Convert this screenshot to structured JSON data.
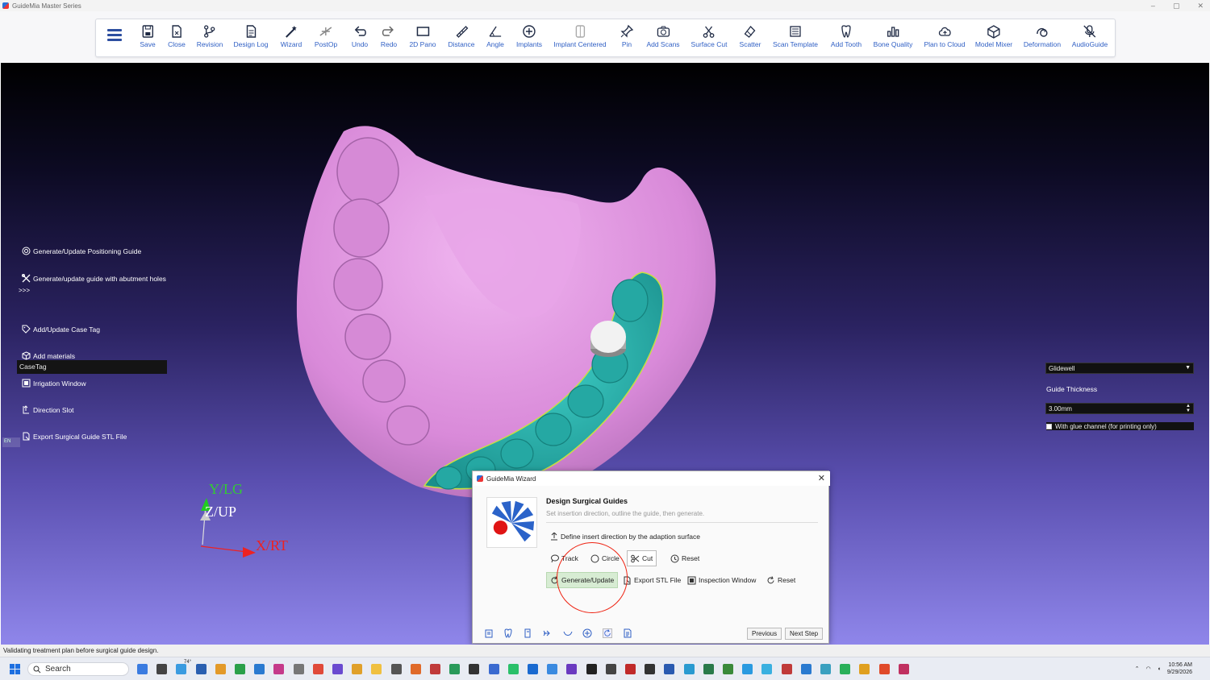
{
  "window": {
    "title": "GuideMia Master Series",
    "controls": [
      "–",
      "▢",
      "✕"
    ]
  },
  "toolbar": {
    "items": [
      {
        "label": "Save",
        "icon": "save-icon"
      },
      {
        "label": "Close",
        "icon": "close-file-icon"
      },
      {
        "label": "Revision",
        "icon": "revision-icon"
      },
      {
        "label": "Design Log",
        "icon": "design-log-icon"
      },
      {
        "label": "Wizard",
        "icon": "wizard-icon"
      },
      {
        "label": "PostOp",
        "icon": "postop-icon"
      },
      {
        "label": "Undo",
        "icon": "undo-icon"
      },
      {
        "label": "Redo",
        "icon": "redo-icon"
      },
      {
        "label": "2D Pano",
        "icon": "pano-icon"
      },
      {
        "label": "Distance",
        "icon": "distance-icon"
      },
      {
        "label": "Angle",
        "icon": "angle-icon"
      },
      {
        "label": "Implants",
        "icon": "implants-icon"
      },
      {
        "label": "Implant Centered",
        "icon": "implant-centered-icon"
      },
      {
        "label": "Pin",
        "icon": "pin-icon"
      },
      {
        "label": "Add Scans",
        "icon": "add-scans-icon"
      },
      {
        "label": "Surface Cut",
        "icon": "surface-cut-icon"
      },
      {
        "label": "Scatter",
        "icon": "scatter-icon"
      },
      {
        "label": "Scan Template",
        "icon": "scan-template-icon"
      },
      {
        "label": "Add Tooth",
        "icon": "add-tooth-icon"
      },
      {
        "label": "Bone Quality",
        "icon": "bone-quality-icon"
      },
      {
        "label": "Plan to Cloud",
        "icon": "cloud-icon"
      },
      {
        "label": "Model Mixer",
        "icon": "model-mixer-icon"
      },
      {
        "label": "Deformation",
        "icon": "deformation-icon"
      },
      {
        "label": "AudioGuide",
        "icon": "audioguide-icon"
      }
    ]
  },
  "left_panel": {
    "toggle": ">>>",
    "items": [
      {
        "label": "Generate/Update Positioning Guide",
        "icon": "target-icon"
      },
      {
        "label": "Generate/update guide with abutment holes",
        "icon": "tools-icon"
      }
    ],
    "casetag_header": "CaseTag",
    "items2": [
      {
        "label": "Add/Update Case Tag",
        "icon": "tag-icon"
      },
      {
        "label": "Add materials",
        "icon": "cube-icon"
      },
      {
        "label": "Irrigation Window",
        "icon": "window-icon"
      },
      {
        "label": "Direction Slot",
        "icon": "slot-icon"
      },
      {
        "label": "Export Surgical Guide STL File",
        "icon": "export-icon"
      }
    ],
    "lang_tag": "EN"
  },
  "right_panel": {
    "select_value": "Glidewell",
    "thickness_label": "Guide Thickness",
    "thickness_value": "3.00mm",
    "glue_label": "With glue channel (for printing only)"
  },
  "axes": {
    "y": "Y/LG",
    "z": "Z/UP",
    "x": "X/RT"
  },
  "wizard": {
    "title": "GuideMia Wizard",
    "heading": "Design Surgical Guides",
    "subheading": "Set insertion direction, outline the guide, then generate.",
    "step": "Define insert direction by the adaption surface",
    "row1": [
      "Track",
      "Circle",
      "Cut",
      "Reset"
    ],
    "row2": [
      "Generate/Update",
      "Export STL File",
      "Inspection Window",
      "Reset"
    ],
    "previous": "Previous",
    "next": "Next Step"
  },
  "status": "Validating treatment plan before surgical guide design.",
  "taskbar": {
    "search": "Search",
    "weather": "74°",
    "time": "10:56 AM",
    "date": "9/29/2026"
  },
  "colors": {
    "accent": "#2f5fc4",
    "model_pink": "#e49be6",
    "guide_teal": "#2fb5b0",
    "viewport_top": "#000000",
    "viewport_bottom": "#8f86ea"
  }
}
